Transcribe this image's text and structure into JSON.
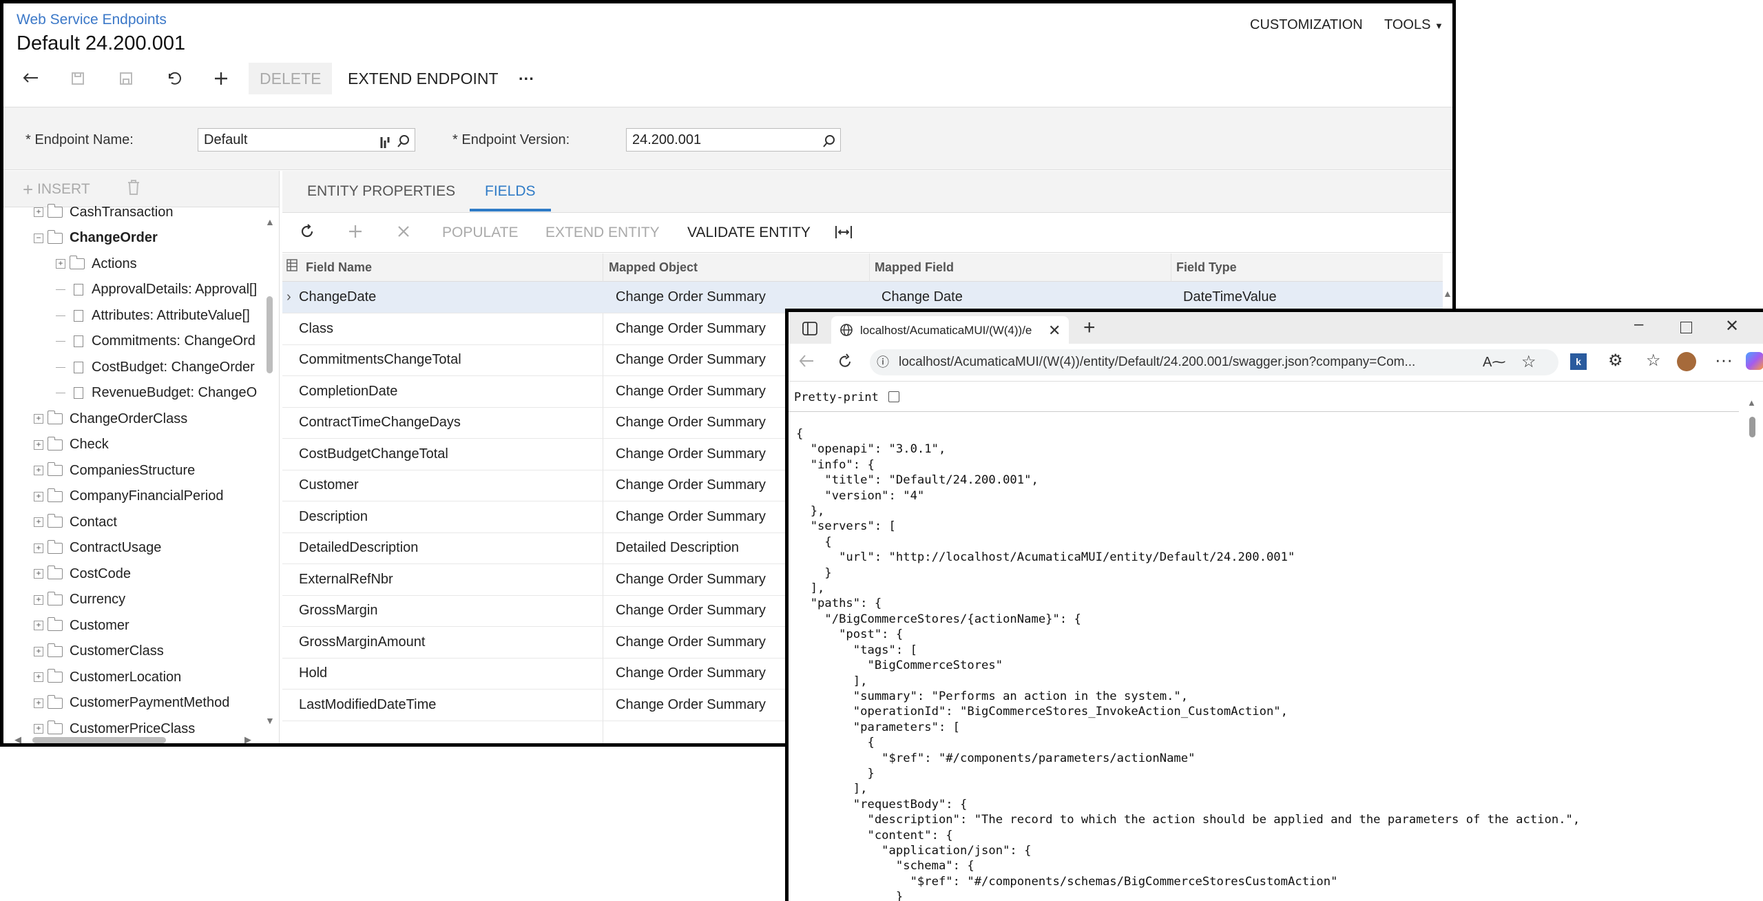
{
  "acumatica": {
    "breadcrumb": "Web Service Endpoints",
    "title": "Default 24.200.001",
    "top_right": [
      "CUSTOMIZATION",
      "TOOLS"
    ],
    "toolbar": {
      "delete_label": "DELETE",
      "extend_endpoint_label": "EXTEND ENDPOINT",
      "more_label": "···"
    },
    "form": {
      "endpoint_name_label": "Endpoint Name:",
      "endpoint_name_value": "Default",
      "endpoint_version_label": "Endpoint Version:",
      "endpoint_version_value": "24.200.001",
      "required_mark": "*"
    },
    "tree": {
      "insert_label": "INSERT",
      "nodes": [
        {
          "label": "CashTransaction",
          "level": 0,
          "type": "folder"
        },
        {
          "label": "ChangeOrder",
          "level": 0,
          "type": "folder",
          "expanded": true,
          "bold": true
        },
        {
          "label": "Actions",
          "level": 1,
          "type": "folder"
        },
        {
          "label": "ApprovalDetails: Approval[]",
          "level": 1,
          "type": "doc"
        },
        {
          "label": "Attributes: AttributeValue[]",
          "level": 1,
          "type": "doc"
        },
        {
          "label": "Commitments: ChangeOrd",
          "level": 1,
          "type": "doc"
        },
        {
          "label": "CostBudget: ChangeOrder",
          "level": 1,
          "type": "doc"
        },
        {
          "label": "RevenueBudget: ChangeO",
          "level": 1,
          "type": "doc"
        },
        {
          "label": "ChangeOrderClass",
          "level": 0,
          "type": "folder"
        },
        {
          "label": "Check",
          "level": 0,
          "type": "folder"
        },
        {
          "label": "CompaniesStructure",
          "level": 0,
          "type": "folder"
        },
        {
          "label": "CompanyFinancialPeriod",
          "level": 0,
          "type": "folder"
        },
        {
          "label": "Contact",
          "level": 0,
          "type": "folder"
        },
        {
          "label": "ContractUsage",
          "level": 0,
          "type": "folder"
        },
        {
          "label": "CostCode",
          "level": 0,
          "type": "folder"
        },
        {
          "label": "Currency",
          "level": 0,
          "type": "folder"
        },
        {
          "label": "Customer",
          "level": 0,
          "type": "folder"
        },
        {
          "label": "CustomerClass",
          "level": 0,
          "type": "folder"
        },
        {
          "label": "CustomerLocation",
          "level": 0,
          "type": "folder"
        },
        {
          "label": "CustomerPaymentMethod",
          "level": 0,
          "type": "folder"
        },
        {
          "label": "CustomerPriceClass",
          "level": 0,
          "type": "folder"
        }
      ]
    },
    "tabs": [
      "ENTITY PROPERTIES",
      "FIELDS"
    ],
    "active_tab": "FIELDS",
    "grid_toolbar": {
      "populate": "POPULATE",
      "extend_entity": "EXTEND ENTITY",
      "validate_entity": "VALIDATE ENTITY"
    },
    "grid": {
      "columns": [
        "Field Name",
        "Mapped Object",
        "Mapped Field",
        "Field Type"
      ],
      "rows": [
        [
          "ChangeDate",
          "Change Order Summary",
          "Change Date",
          "DateTimeValue"
        ],
        [
          "Class",
          "Change Order Summary",
          "",
          ""
        ],
        [
          "CommitmentsChangeTotal",
          "Change Order Summary",
          "",
          ""
        ],
        [
          "CompletionDate",
          "Change Order Summary",
          "",
          ""
        ],
        [
          "ContractTimeChangeDays",
          "Change Order Summary",
          "",
          ""
        ],
        [
          "CostBudgetChangeTotal",
          "Change Order Summary",
          "",
          ""
        ],
        [
          "Customer",
          "Change Order Summary",
          "",
          ""
        ],
        [
          "Description",
          "Change Order Summary",
          "",
          ""
        ],
        [
          "DetailedDescription",
          "Detailed Description",
          "",
          ""
        ],
        [
          "ExternalRefNbr",
          "Change Order Summary",
          "",
          ""
        ],
        [
          "GrossMargin",
          "Change Order Summary",
          "",
          ""
        ],
        [
          "GrossMarginAmount",
          "Change Order Summary",
          "",
          ""
        ],
        [
          "Hold",
          "Change Order Summary",
          "",
          ""
        ],
        [
          "LastModifiedDateTime",
          "Change Order Summary",
          "",
          ""
        ]
      ]
    }
  },
  "browser": {
    "tab_title": "localhost/AcumaticaMUI/(W(4))/e",
    "url": "localhost/AcumaticaMUI/(W(4))/entity/Default/24.200.001/swagger.json?company=Com...",
    "pretty_print_label": "Pretty-print",
    "json_lines": [
      "{",
      "  \"openapi\": \"3.0.1\",",
      "  \"info\": {",
      "    \"title\": \"Default/24.200.001\",",
      "    \"version\": \"4\"",
      "  },",
      "  \"servers\": [",
      "    {",
      "      \"url\": \"http://localhost/AcumaticaMUI/entity/Default/24.200.001\"",
      "    }",
      "  ],",
      "  \"paths\": {",
      "    \"/BigCommerceStores/{actionName}\": {",
      "      \"post\": {",
      "        \"tags\": [",
      "          \"BigCommerceStores\"",
      "        ],",
      "        \"summary\": \"Performs an action in the system.\",",
      "        \"operationId\": \"BigCommerceStores_InvokeAction_CustomAction\",",
      "        \"parameters\": [",
      "          {",
      "            \"$ref\": \"#/components/parameters/actionName\"",
      "          }",
      "        ],",
      "        \"requestBody\": {",
      "          \"description\": \"The record to which the action should be applied and the parameters of the action.\",",
      "          \"content\": {",
      "            \"application/json\": {",
      "              \"schema\": {",
      "                \"$ref\": \"#/components/schemas/BigCommerceStoresCustomAction\"",
      "              }",
      "            },"
    ]
  }
}
